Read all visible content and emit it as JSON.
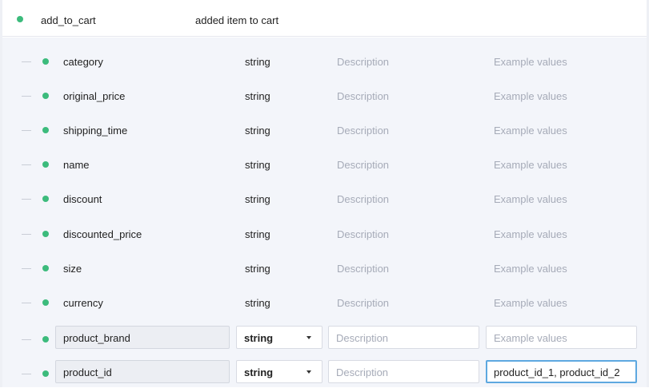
{
  "event": {
    "name": "add_to_cart",
    "description": "added item to cart",
    "status_color": "#3cbb7c"
  },
  "properties": [
    {
      "name": "category",
      "type": "string",
      "description": "Description",
      "example": "Example values"
    },
    {
      "name": "original_price",
      "type": "string",
      "description": "Description",
      "example": "Example values"
    },
    {
      "name": "shipping_time",
      "type": "string",
      "description": "Description",
      "example": "Example values"
    },
    {
      "name": "name",
      "type": "string",
      "description": "Description",
      "example": "Example values"
    },
    {
      "name": "discount",
      "type": "string",
      "description": "Description",
      "example": "Example values"
    },
    {
      "name": "discounted_price",
      "type": "string",
      "description": "Description",
      "example": "Example values"
    },
    {
      "name": "size",
      "type": "string",
      "description": "Description",
      "example": "Example values"
    },
    {
      "name": "currency",
      "type": "string",
      "description": "Description",
      "example": "Example values"
    }
  ],
  "editing_rows": [
    {
      "name": "product_brand",
      "type": "string",
      "description_placeholder": "Description",
      "example_placeholder": "Example values",
      "example_value": ""
    },
    {
      "name": "product_id",
      "type": "string",
      "description_placeholder": "Description",
      "example_placeholder": "Example values",
      "example_value": "product_id_1, product_id_2"
    }
  ]
}
